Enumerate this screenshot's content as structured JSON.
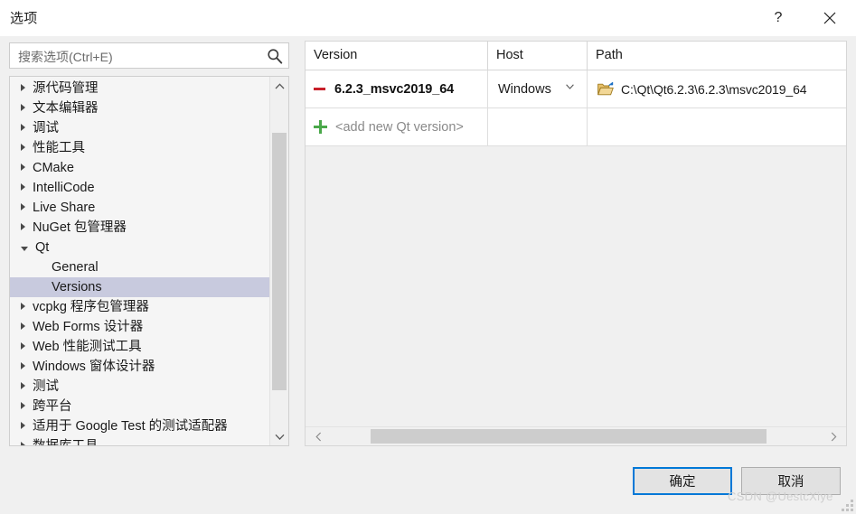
{
  "window": {
    "title": "选项",
    "help_icon": "question-mark-icon",
    "close_icon": "close-icon"
  },
  "search": {
    "placeholder": "搜索选项(Ctrl+E)",
    "value": "",
    "icon": "search-icon"
  },
  "tree": {
    "items": [
      {
        "label": "源代码管理",
        "state": "collapsed",
        "level": 0,
        "selected": false
      },
      {
        "label": "文本编辑器",
        "state": "collapsed",
        "level": 0,
        "selected": false
      },
      {
        "label": "调试",
        "state": "collapsed",
        "level": 0,
        "selected": false
      },
      {
        "label": "性能工具",
        "state": "collapsed",
        "level": 0,
        "selected": false
      },
      {
        "label": "CMake",
        "state": "collapsed",
        "level": 0,
        "selected": false
      },
      {
        "label": "IntelliCode",
        "state": "collapsed",
        "level": 0,
        "selected": false
      },
      {
        "label": "Live Share",
        "state": "collapsed",
        "level": 0,
        "selected": false
      },
      {
        "label": "NuGet 包管理器",
        "state": "collapsed",
        "level": 0,
        "selected": false
      },
      {
        "label": "Qt",
        "state": "expanded",
        "level": 0,
        "selected": false
      },
      {
        "label": "General",
        "state": "leaf",
        "level": 1,
        "selected": false
      },
      {
        "label": "Versions",
        "state": "leaf",
        "level": 1,
        "selected": true
      },
      {
        "label": "vcpkg 程序包管理器",
        "state": "collapsed",
        "level": 0,
        "selected": false
      },
      {
        "label": "Web Forms 设计器",
        "state": "collapsed",
        "level": 0,
        "selected": false
      },
      {
        "label": "Web 性能测试工具",
        "state": "collapsed",
        "level": 0,
        "selected": false
      },
      {
        "label": "Windows 窗体设计器",
        "state": "collapsed",
        "level": 0,
        "selected": false
      },
      {
        "label": "测试",
        "state": "collapsed",
        "level": 0,
        "selected": false
      },
      {
        "label": "跨平台",
        "state": "collapsed",
        "level": 0,
        "selected": false
      },
      {
        "label": "适用于 Google Test 的测试适配器",
        "state": "collapsed",
        "level": 0,
        "selected": false
      },
      {
        "label": "数据库工具",
        "state": "collapsed",
        "level": 0,
        "selected": false
      }
    ],
    "scrollbar": {
      "up_icon": "chevron-up-icon",
      "down_icon": "chevron-down-icon"
    }
  },
  "grid": {
    "columns": [
      "Version",
      "Host",
      "Path"
    ],
    "rows": [
      {
        "leading_icon": "remove-minus-icon",
        "version": "6.2.3_msvc2019_64",
        "host": "Windows",
        "host_caret_icon": "chevron-down-icon",
        "path_icon": "open-folder-icon",
        "path": "C:\\Qt\\Qt6.2.3\\6.2.3\\msvc2019_64"
      },
      {
        "leading_icon": "add-plus-icon",
        "version": "<add new Qt version>",
        "host": "",
        "path": ""
      }
    ],
    "hscrollbar": {
      "left_icon": "chevron-left-icon",
      "right_icon": "chevron-right-icon"
    }
  },
  "footer": {
    "ok_label": "确定",
    "cancel_label": "取消"
  },
  "watermark": "CSDN @UestcXiye",
  "colors": {
    "accent": "#0078d7",
    "selection": "#c8cade",
    "remove": "#c8202a",
    "add": "#4aa84a",
    "folder": "#dba62a",
    "dialog_bg": "#f0f0f0"
  }
}
